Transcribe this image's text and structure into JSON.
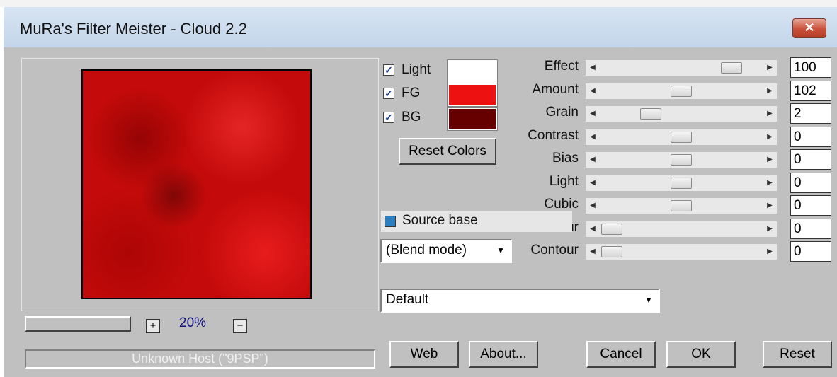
{
  "window": {
    "title": "MuRa's Filter Meister - Cloud 2.2",
    "close_glyph": "✕"
  },
  "preview": {
    "zoom": "20%",
    "zoom_in": "+",
    "zoom_out": "−",
    "host": "Unknown Host (\"9PSP\")"
  },
  "colors": {
    "items": [
      {
        "label": "Light",
        "checked": true,
        "check_glyph": "✓",
        "swatch": "#ffffff"
      },
      {
        "label": "FG",
        "checked": true,
        "check_glyph": "✓",
        "swatch": "#ee1111"
      },
      {
        "label": "BG",
        "checked": true,
        "check_glyph": "✓",
        "swatch": "#660000"
      }
    ],
    "reset_label": "Reset Colors"
  },
  "source_base": {
    "label": "Source base"
  },
  "blend_mode": {
    "value": "(Blend mode)"
  },
  "preset": {
    "value": "Default"
  },
  "sliders": [
    {
      "label": "Effect",
      "value": "100",
      "position": 0.86
    },
    {
      "label": "Amount",
      "value": "102",
      "position": 0.5
    },
    {
      "label": "Grain",
      "value": "2",
      "position": 0.28
    },
    {
      "label": "Contrast",
      "value": "0",
      "position": 0.5
    },
    {
      "label": "Bias",
      "value": "0",
      "position": 0.5
    },
    {
      "label": "Light",
      "value": "0",
      "position": 0.5
    },
    {
      "label": "Cubic",
      "value": "0",
      "position": 0.5
    },
    {
      "label": "Blur",
      "value": "0",
      "position": 0.0
    },
    {
      "label": "Contour",
      "value": "0",
      "position": 0.0
    }
  ],
  "buttons": {
    "web": "Web",
    "about": "About...",
    "cancel": "Cancel",
    "ok": "OK",
    "reset": "Reset"
  },
  "icons": {
    "arrow_left": "◀",
    "arrow_right": "▶",
    "dropdown": "▼"
  }
}
